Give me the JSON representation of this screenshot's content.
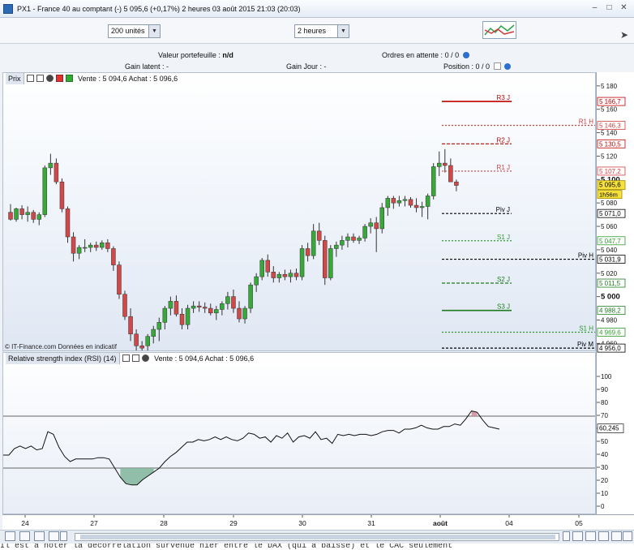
{
  "window": {
    "title": "PX1 - France 40 au comptant (-)   5 095,6 (+0,17%)   2 heures  03 août 2015 21:03 (20:03)",
    "controls": [
      "minimize-icon",
      "maximize-icon",
      "close-icon"
    ]
  },
  "toolbar": {
    "units_value": "200 unités",
    "period_value": "2 heures"
  },
  "info": {
    "portfolio_label": "Valeur portefeuille :",
    "portfolio_value": "n/d",
    "orders_label": "Ordres en attente :",
    "orders_value": "0 / 0",
    "latent_label": "Gain latent :",
    "latent_value": "-",
    "day_label": "Gain Jour :",
    "day_value": "-",
    "position_label": "Position :",
    "position_value": "0 / 0"
  },
  "price_panel": {
    "tag": "Prix",
    "quote": "Vente : 5 094,6 Achat : 5 096,6",
    "watermark": "© IT-Finance.com  Données en indicatif"
  },
  "rsi_panel": {
    "tag": "Relative strength index (RSI) (14)",
    "quote": "Vente : 5 094,6 Achat : 5 096,6",
    "last_value": "60,245"
  },
  "price_axis": {
    "ticks": [
      "5 180",
      "5 160",
      "5 140",
      "5 120",
      "5 100",
      "5 080",
      "5 060",
      "5 040",
      "5 020",
      "5 000",
      "4 980",
      "4 960"
    ],
    "current_price": "5 095,6",
    "countdown": "1h56m"
  },
  "rsi_axis": {
    "ticks": [
      "100",
      "90",
      "80",
      "70",
      "60",
      "50",
      "40",
      "30",
      "20",
      "10",
      "0"
    ]
  },
  "x_axis": {
    "ticks": [
      "24",
      "27",
      "28",
      "29",
      "30",
      "31",
      "août",
      "04",
      "05"
    ]
  },
  "pivot_levels": [
    {
      "label": "R3 J",
      "value": "5 166,7",
      "color": "#c00000"
    },
    {
      "label": "R1 H",
      "value": "5 146,3",
      "color": "#d04040"
    },
    {
      "label": "R2 J",
      "value": "5 130,5",
      "color": "#c00000"
    },
    {
      "label": "R1 J",
      "value": "5 107,2",
      "color": "#d04040"
    },
    {
      "label": "Piv J",
      "value": "5 071,0",
      "color": "#000000"
    },
    {
      "label": "S1 J",
      "value": "5 047,7",
      "color": "#2e9a2e"
    },
    {
      "label": "Piv H",
      "value": "5 031,9",
      "color": "#000000"
    },
    {
      "label": "S2 J",
      "value": "5 011,5",
      "color": "#1e7a1e"
    },
    {
      "label": "S3 J",
      "value": "4 988,2",
      "color": "#1e7a1e"
    },
    {
      "label": "S1 H",
      "value": "4 969,6",
      "color": "#2e9a2e"
    },
    {
      "label": "Piv M",
      "value": "4 956,0",
      "color": "#000000"
    }
  ],
  "footer_text": "Il est à noter la décorrélation survenue hier entre le DAX  (qui a baissé)  et le CAC seulement",
  "colors": {
    "up": "#38a838",
    "down": "#d04848",
    "rsi_over": "#d08c9c",
    "rsi_under": "#7fb59a"
  },
  "chart_data": [
    {
      "type": "candlestick",
      "title": "",
      "ylabel": "",
      "ylim": [
        4954,
        5191
      ],
      "x_labels": [
        "24",
        "27",
        "28",
        "29",
        "30",
        "31",
        "août",
        "04",
        "05"
      ],
      "candles": [
        [
          5072,
          5079,
          5065,
          5066
        ],
        [
          5066,
          5076,
          5064,
          5075
        ],
        [
          5075,
          5078,
          5066,
          5070
        ],
        [
          5070,
          5077,
          5064,
          5072
        ],
        [
          5072,
          5074,
          5063,
          5066
        ],
        [
          5066,
          5072,
          5061,
          5070
        ],
        [
          5070,
          5112,
          5068,
          5110
        ],
        [
          5110,
          5122,
          5104,
          5114
        ],
        [
          5114,
          5118,
          5096,
          5098
        ],
        [
          5098,
          5101,
          5072,
          5075
        ],
        [
          5075,
          5077,
          5046,
          5051
        ],
        [
          5051,
          5055,
          5030,
          5037
        ],
        [
          5037,
          5044,
          5032,
          5042
        ],
        [
          5042,
          5049,
          5038,
          5042
        ],
        [
          5042,
          5046,
          5038,
          5044
        ],
        [
          5044,
          5047,
          5039,
          5042
        ],
        [
          5042,
          5048,
          5040,
          5046
        ],
        [
          5046,
          5049,
          5038,
          5041
        ],
        [
          5041,
          5043,
          5022,
          5027
        ],
        [
          5027,
          5030,
          4998,
          5002
        ],
        [
          5002,
          5005,
          4980,
          4983
        ],
        [
          4983,
          4990,
          4962,
          4968
        ],
        [
          4968,
          4972,
          4954,
          4958
        ],
        [
          4958,
          4962,
          4954,
          4956
        ],
        [
          4958,
          4968,
          4954,
          4966
        ],
        [
          4966,
          4975,
          4960,
          4972
        ],
        [
          4972,
          4982,
          4962,
          4978
        ],
        [
          4978,
          4992,
          4972,
          4990
        ],
        [
          4990,
          5000,
          4984,
          4996
        ],
        [
          4996,
          5001,
          4983,
          4985
        ],
        [
          4985,
          4990,
          4972,
          4976
        ],
        [
          4976,
          4993,
          4972,
          4990
        ],
        [
          4990,
          4996,
          4986,
          4992
        ],
        [
          4992,
          4996,
          4987,
          4991
        ],
        [
          4991,
          4995,
          4986,
          4990
        ],
        [
          4990,
          4994,
          4984,
          4986
        ],
        [
          4986,
          4992,
          4980,
          4989
        ],
        [
          4989,
          4996,
          4984,
          4994
        ],
        [
          4994,
          5004,
          4989,
          5000
        ],
        [
          5000,
          5006,
          4986,
          4990
        ],
        [
          4990,
          4996,
          4978,
          4981
        ],
        [
          4981,
          4992,
          4977,
          4990
        ],
        [
          4990,
          5012,
          4986,
          5010
        ],
        [
          5010,
          5020,
          5004,
          5017
        ],
        [
          5017,
          5033,
          5014,
          5031
        ],
        [
          5031,
          5036,
          5017,
          5021
        ],
        [
          5021,
          5026,
          5012,
          5016
        ],
        [
          5016,
          5021,
          5012,
          5019
        ],
        [
          5019,
          5023,
          5014,
          5017
        ],
        [
          5017,
          5023,
          5012,
          5020
        ],
        [
          5020,
          5024,
          5014,
          5017
        ],
        [
          5017,
          5044,
          5014,
          5041
        ],
        [
          5041,
          5046,
          5030,
          5035
        ],
        [
          5035,
          5062,
          5032,
          5056
        ],
        [
          5056,
          5063,
          5044,
          5048
        ],
        [
          5048,
          5052,
          5010,
          5016
        ],
        [
          5016,
          5044,
          5014,
          5041
        ],
        [
          5041,
          5047,
          5034,
          5044
        ],
        [
          5044,
          5052,
          5040,
          5048
        ],
        [
          5048,
          5054,
          5042,
          5051
        ],
        [
          5051,
          5054,
          5046,
          5048
        ],
        [
          5048,
          5052,
          5045,
          5050
        ],
        [
          5050,
          5062,
          5047,
          5060
        ],
        [
          5060,
          5067,
          5054,
          5063
        ],
        [
          5063,
          5068,
          5038,
          5058
        ],
        [
          5058,
          5080,
          5054,
          5076
        ],
        [
          5076,
          5086,
          5069,
          5084
        ],
        [
          5084,
          5086,
          5075,
          5080
        ],
        [
          5080,
          5086,
          5077,
          5082
        ],
        [
          5082,
          5086,
          5077,
          5083
        ],
        [
          5083,
          5085,
          5076,
          5078
        ],
        [
          5078,
          5084,
          5072,
          5076
        ],
        [
          5076,
          5081,
          5068,
          5077
        ],
        [
          5077,
          5088,
          5066,
          5086
        ],
        [
          5086,
          5114,
          5083,
          5111
        ],
        [
          5111,
          5124,
          5103,
          5114
        ],
        [
          5114,
          5126,
          5106,
          5112
        ],
        [
          5112,
          5118,
          5098,
          5098
        ],
        [
          5098,
          5100,
          5090,
          5095
        ]
      ]
    },
    {
      "type": "line",
      "title": "",
      "ylabel": "",
      "ylim": [
        0,
        100
      ],
      "overbought": 70,
      "oversold": 30,
      "values": [
        40,
        40,
        45,
        47,
        45,
        47,
        44,
        45,
        58,
        56,
        46,
        39,
        35,
        37,
        37,
        37,
        37,
        38,
        38,
        37,
        30,
        23,
        18,
        17,
        17,
        21,
        24,
        27,
        30,
        35,
        39,
        42,
        46,
        50,
        50,
        52,
        51,
        52,
        54,
        52,
        54,
        52,
        51,
        53,
        57,
        56,
        53,
        54,
        50,
        55,
        53,
        57,
        50,
        54,
        55,
        53,
        58,
        52,
        53,
        49,
        56,
        55,
        56,
        55,
        56,
        56,
        55,
        56,
        58,
        59,
        59,
        57,
        60,
        60,
        61,
        63,
        61,
        60,
        60,
        62,
        62,
        64,
        63,
        68,
        74,
        73,
        67,
        62,
        61,
        60
      ]
    }
  ]
}
